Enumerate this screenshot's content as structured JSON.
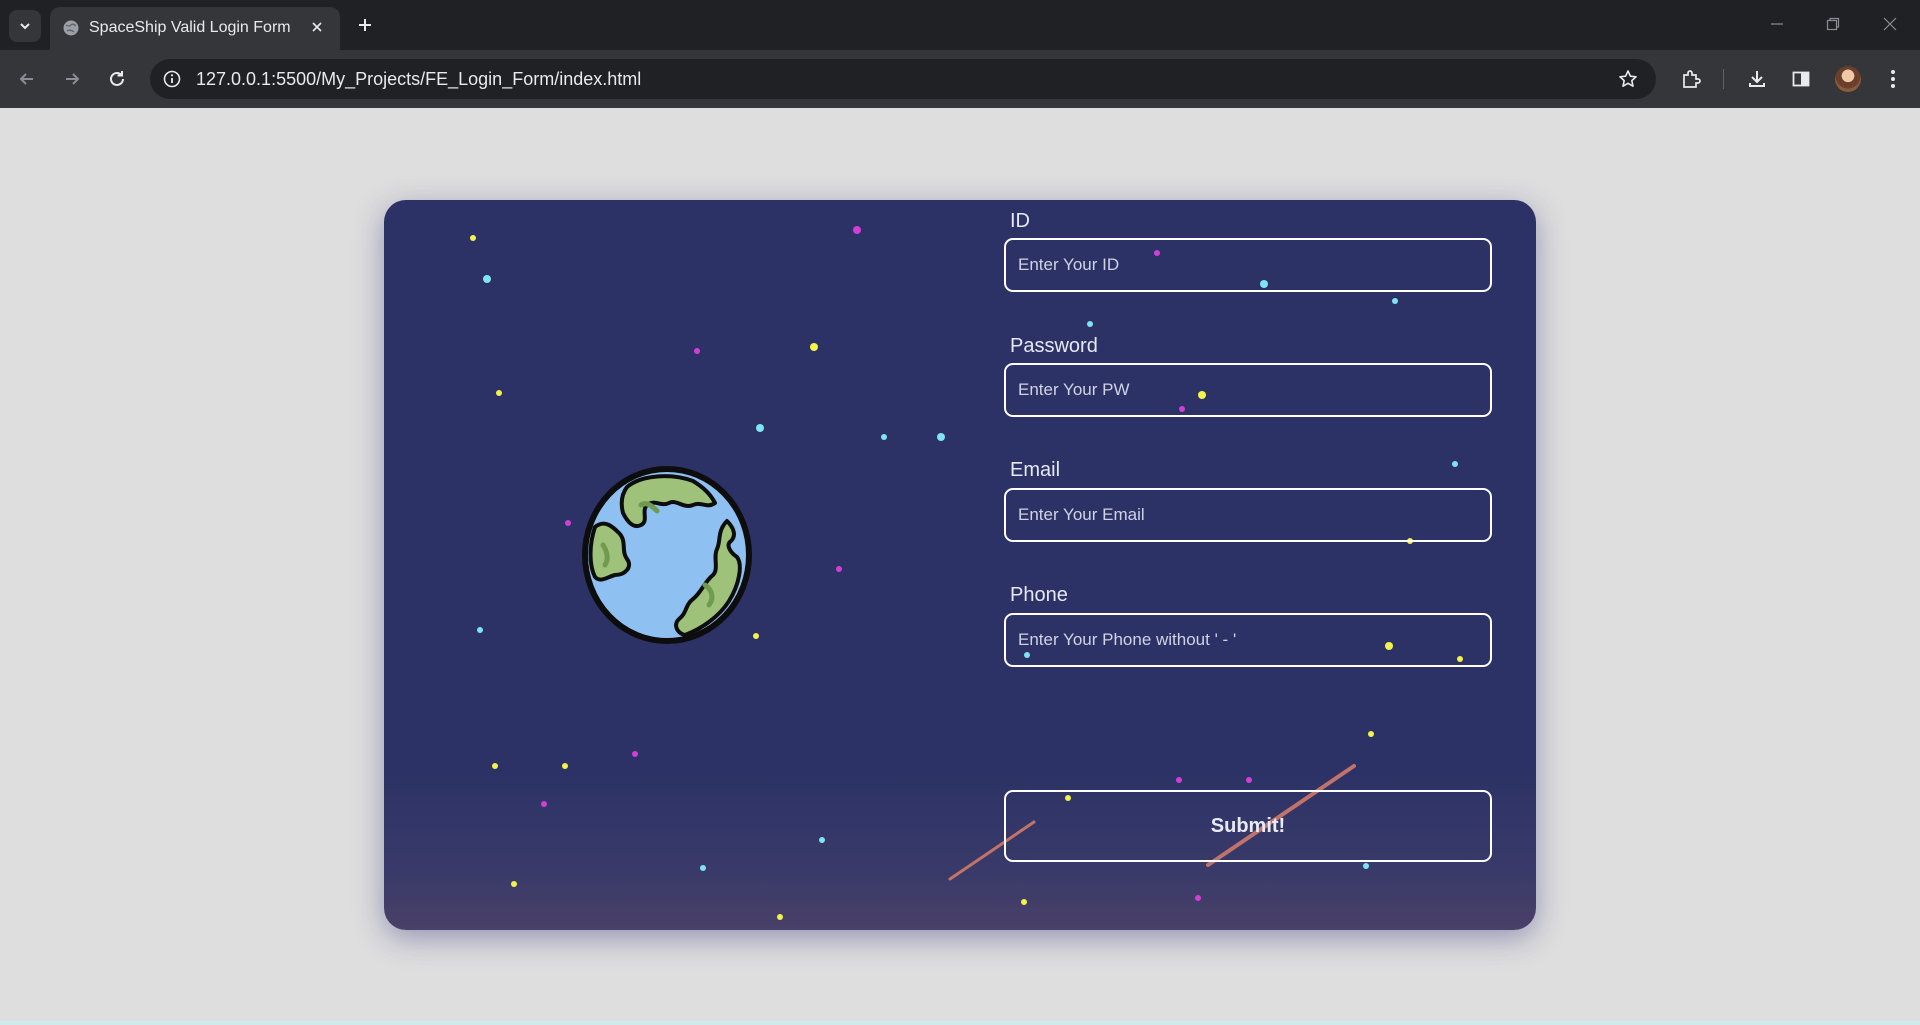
{
  "browser": {
    "tab_title": "SpaceShip Valid Login Form",
    "url": "127.0.0.1:5500/My_Projects/FE_Login_Form/index.html",
    "icons": [
      "tab-search-icon",
      "globe-icon",
      "close-icon",
      "plus-icon",
      "minimize-icon",
      "restore-icon",
      "close-window-icon",
      "back-arrow-icon",
      "forward-arrow-icon",
      "reload-icon",
      "info-icon",
      "star-icon",
      "extensions-icon",
      "download-icon",
      "side-panel-icon",
      "avatar",
      "more-vert-icon"
    ]
  },
  "form": {
    "id": {
      "label": "ID",
      "placeholder": "Enter Your ID",
      "value": ""
    },
    "password": {
      "label": "Password",
      "placeholder": "Enter Your PW",
      "value": ""
    },
    "email": {
      "label": "Email",
      "placeholder": "Enter Your Email",
      "value": ""
    },
    "phone": {
      "label": "Phone",
      "placeholder": "Enter Your Phone without ' - '",
      "value": ""
    },
    "submit_label": "Submit!"
  },
  "colors": {
    "card_bg": "#2c3266",
    "page_bg": "#dedede",
    "star_yellow": "#f3f34a",
    "star_cyan": "#7fe3f2",
    "star_magenta": "#d23fd7",
    "meteor": "#d27a6a"
  }
}
